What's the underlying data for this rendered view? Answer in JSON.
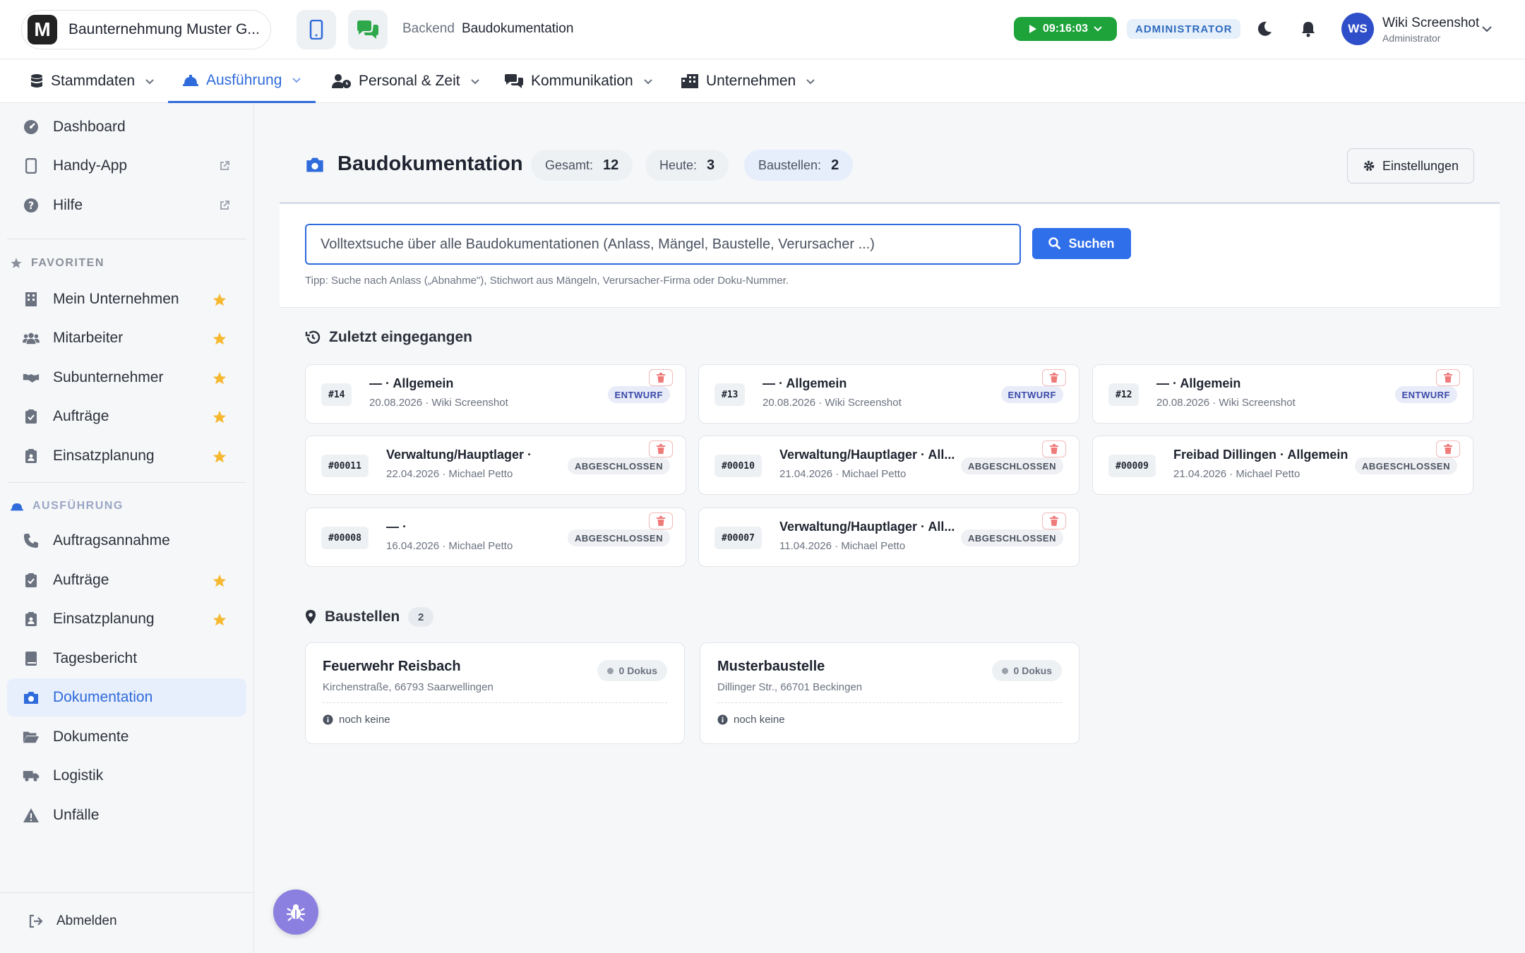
{
  "company": {
    "logo_letter": "M",
    "name": "Baunternehmung Muster G..."
  },
  "breadcrumb": {
    "section": "Backend",
    "page": "Baudokumentation"
  },
  "timer": {
    "value": "09:16:03"
  },
  "role_badge": "ADMINISTRATOR",
  "user": {
    "initials": "WS",
    "name": "Wiki Screenshot",
    "role": "Administrator"
  },
  "nav": [
    {
      "label": "Stammdaten",
      "icon": "database-icon"
    },
    {
      "label": "Ausführung",
      "icon": "hardhat-icon",
      "active": true
    },
    {
      "label": "Personal & Zeit",
      "icon": "user-clock-icon"
    },
    {
      "label": "Kommunikation",
      "icon": "comments-icon"
    },
    {
      "label": "Unternehmen",
      "icon": "building-icon"
    }
  ],
  "sidebar": {
    "top": [
      {
        "label": "Dashboard",
        "icon": "gauge-icon"
      },
      {
        "label": "Handy-App",
        "icon": "mobile-icon",
        "external": true
      },
      {
        "label": "Hilfe",
        "icon": "question-icon",
        "external": true
      }
    ],
    "favorites_heading": "FAVORITEN",
    "favorites": [
      {
        "label": "Mein Unternehmen",
        "icon": "building-icon"
      },
      {
        "label": "Mitarbeiter",
        "icon": "users-icon"
      },
      {
        "label": "Subunternehmer",
        "icon": "handshake-icon"
      },
      {
        "label": "Aufträge",
        "icon": "clipboard-check-icon"
      },
      {
        "label": "Einsatzplanung",
        "icon": "clipboard-user-icon"
      }
    ],
    "section_heading": "AUSFÜHRUNG",
    "section": [
      {
        "label": "Auftragsannahme",
        "icon": "phone-icon"
      },
      {
        "label": "Aufträge",
        "icon": "clipboard-check-icon",
        "starred": true
      },
      {
        "label": "Einsatzplanung",
        "icon": "clipboard-user-icon",
        "starred": true
      },
      {
        "label": "Tagesbericht",
        "icon": "book-icon"
      },
      {
        "label": "Dokumentation",
        "icon": "camera-icon",
        "active": true
      },
      {
        "label": "Dokumente",
        "icon": "folder-open-icon"
      },
      {
        "label": "Logistik",
        "icon": "truck-icon"
      },
      {
        "label": "Unfälle",
        "icon": "warning-icon"
      }
    ],
    "logout": "Abmelden"
  },
  "page": {
    "title": "Baudokumentation",
    "stats": [
      {
        "label": "Gesamt:",
        "value": "12"
      },
      {
        "label": "Heute:",
        "value": "3"
      },
      {
        "label": "Baustellen:",
        "value": "2"
      }
    ],
    "settings_label": "Einstellungen"
  },
  "search": {
    "placeholder": "Volltextsuche über alle Baudokumentationen (Anlass, Mängel, Baustelle, Verursacher ...)",
    "button": "Suchen",
    "tip": "Tipp: Suche nach Anlass („Abnahme\"), Stichwort aus Mängeln, Verursacher-Firma oder Doku-Nummer."
  },
  "recent": {
    "heading": "Zuletzt eingegangen",
    "items": [
      {
        "num": "#14",
        "title": "— · Allgemein",
        "meta": "20.08.2026 · Wiki Screenshot",
        "status": "ENTWURF"
      },
      {
        "num": "#13",
        "title": "— · Allgemein",
        "meta": "20.08.2026 · Wiki Screenshot",
        "status": "ENTWURF"
      },
      {
        "num": "#12",
        "title": "— · Allgemein",
        "meta": "20.08.2026 · Wiki Screenshot",
        "status": "ENTWURF"
      },
      {
        "num": "#00011",
        "title": "Verwaltung/Hauptlager ·",
        "meta": "22.04.2026 · Michael Petto",
        "status": "ABGESCHLOSSEN"
      },
      {
        "num": "#00010",
        "title": "Verwaltung/Hauptlager · All...",
        "meta": "21.04.2026 · Michael Petto",
        "status": "ABGESCHLOSSEN"
      },
      {
        "num": "#00009",
        "title": "Freibad Dillingen · Allgemein",
        "meta": "21.04.2026 · Michael Petto",
        "status": "ABGESCHLOSSEN"
      },
      {
        "num": "#00008",
        "title": "— ·",
        "meta": "16.04.2026 · Michael Petto",
        "status": "ABGESCHLOSSEN"
      },
      {
        "num": "#00007",
        "title": "Verwaltung/Hauptlager · All...",
        "meta": "11.04.2026 · Michael Petto",
        "status": "ABGESCHLOSSEN"
      }
    ]
  },
  "sites": {
    "heading": "Baustellen",
    "count": "2",
    "items": [
      {
        "name": "Feuerwehr Reisbach",
        "address": "Kirchenstraße, 66793 Saarwellingen",
        "docs": "0 Dokus",
        "note": "noch keine"
      },
      {
        "name": "Musterbaustelle",
        "address": "Dillinger Str., 66701 Beckingen",
        "docs": "0 Dokus",
        "note": "noch keine"
      }
    ]
  },
  "colors": {
    "accent": "#2f6bdb",
    "timer": "#1da33a",
    "star": "#f5b82e",
    "bug": "#8b7fe0"
  }
}
